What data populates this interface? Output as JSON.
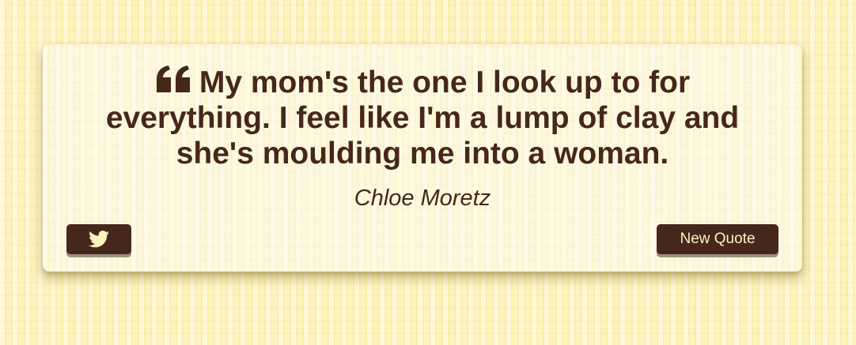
{
  "quote": {
    "icon": "quote-left-icon",
    "text": "My mom's the one I look up to for everything. I feel like I'm a lump of clay and she's moulding me into a woman.",
    "author": "Chloe Moretz"
  },
  "actions": {
    "tweet_icon": "twitter-icon",
    "new_quote_label": "New Quote"
  },
  "colors": {
    "background": "#fdf3bd",
    "card": "#fdf8dc",
    "text": "#46271b",
    "button": "#46271b",
    "button_text": "#fdf3bd"
  }
}
